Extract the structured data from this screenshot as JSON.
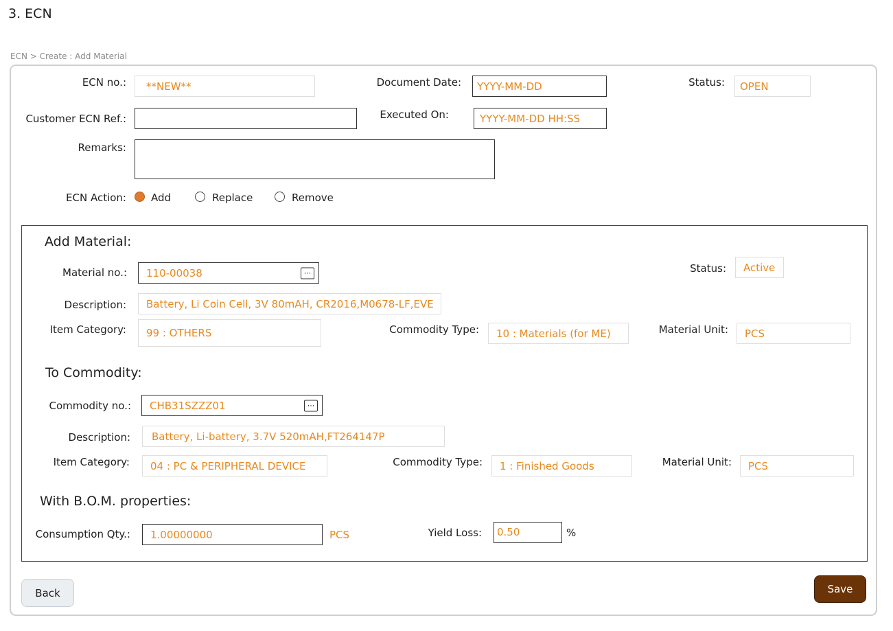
{
  "page": {
    "title": "3. ECN",
    "breadcrumb": "ECN > Create : Add Material"
  },
  "header": {
    "ecn_no": {
      "label": "ECN no.:",
      "value": "**NEW**"
    },
    "document_date": {
      "label": "Document Date:",
      "value": "YYYY-MM-DD"
    },
    "status": {
      "label": "Status:",
      "value": "OPEN"
    },
    "customer_ref": {
      "label": "Customer ECN Ref.:",
      "value": ""
    },
    "executed_on": {
      "label": "Executed On:",
      "value": "YYYY-MM-DD HH:SS"
    },
    "remarks": {
      "label": "Remarks:",
      "value": ""
    },
    "ecn_action": {
      "label": "ECN Action:",
      "options": [
        "Add",
        "Replace",
        "Remove"
      ],
      "selected": "Add"
    }
  },
  "add_material": {
    "title": "Add Material:",
    "material_no": {
      "label": "Material no.:",
      "value": "110-00038"
    },
    "status": {
      "label": "Status:",
      "value": "Active"
    },
    "description": {
      "label": "Description:",
      "value": "Battery, Li Coin Cell, 3V 80mAH, CR2016,M0678-LF,EVE"
    },
    "item_category": {
      "label": "Item Category:",
      "value": "99 : OTHERS"
    },
    "commodity_type": {
      "label": "Commodity Type:",
      "value": "10 : Materials (for ME)"
    },
    "material_unit": {
      "label": "Material Unit:",
      "value": "PCS"
    }
  },
  "to_commodity": {
    "title": "To Commodity:",
    "commodity_no": {
      "label": "Commodity no.:",
      "value": "CHB31SZZZ01"
    },
    "description": {
      "label": "Description:",
      "value": "Battery, Li-battery, 3.7V 520mAH,FT264147P"
    },
    "item_category": {
      "label": "Item Category:",
      "value": "04 : PC & PERIPHERAL DEVICE"
    },
    "commodity_type": {
      "label": "Commodity Type:",
      "value": "1 : Finished Goods"
    },
    "material_unit": {
      "label": "Material Unit:",
      "value": "PCS"
    }
  },
  "bom": {
    "title": "With B.O.M. properties:",
    "consumption_qty": {
      "label": "Consumption Qty.:",
      "value": "1.00000000",
      "unit": "PCS"
    },
    "yield_loss": {
      "label": "Yield Loss:",
      "value": "0.50",
      "unit": "%"
    }
  },
  "actions": {
    "back_label": "Back",
    "save_label": "Save",
    "lookup_glyph": "···"
  },
  "icons": {
    "lookup": "ellipsis-icon"
  },
  "colors": {
    "value_text": "#e8891e",
    "radio_selected": "#e07b2b",
    "save_button": "#6b3308"
  }
}
